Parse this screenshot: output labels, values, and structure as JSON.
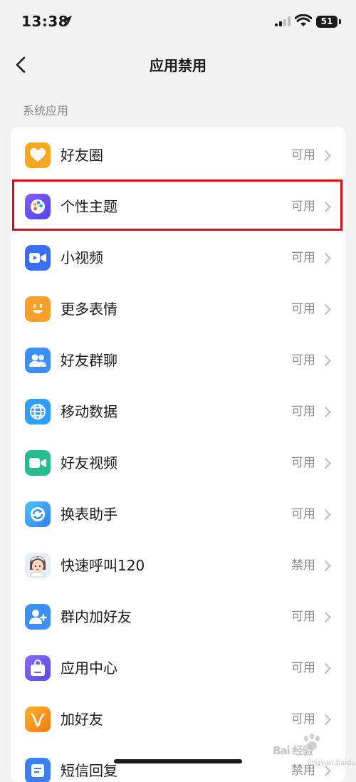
{
  "status_bar": {
    "time": "13:38",
    "battery": "51"
  },
  "nav": {
    "title": "应用禁用"
  },
  "section": {
    "label": "系统应用"
  },
  "apps": [
    {
      "name": "好友圈",
      "status": "可用",
      "icon": "heart-icon",
      "color": "#f5a623"
    },
    {
      "name": "个性主题",
      "status": "可用",
      "icon": "palette-icon",
      "color": "#6f55f2"
    },
    {
      "name": "小视频",
      "status": "可用",
      "icon": "video-camera-icon",
      "color": "#3b6ff3"
    },
    {
      "name": "更多表情",
      "status": "可用",
      "icon": "smiley-icon",
      "color": "#f6a12c"
    },
    {
      "name": "好友群聊",
      "status": "可用",
      "icon": "group-chat-icon",
      "color": "#3b8ff5"
    },
    {
      "name": "移动数据",
      "status": "可用",
      "icon": "globe-icon",
      "color": "#2d9ff5"
    },
    {
      "name": "好友视频",
      "status": "可用",
      "icon": "video-call-icon",
      "color": "#25bd8f"
    },
    {
      "name": "换表助手",
      "status": "可用",
      "icon": "sync-icon",
      "color": "#2f95f5"
    },
    {
      "name": "快速呼叫120",
      "status": "禁用",
      "icon": "nurse-avatar-icon",
      "color": "#e8eef5"
    },
    {
      "name": "群内加好友",
      "status": "可用",
      "icon": "add-friend-icon",
      "color": "#3b8ff5"
    },
    {
      "name": "应用中心",
      "status": "可用",
      "icon": "bag-icon",
      "color": "#7a5cf2"
    },
    {
      "name": "加好友",
      "status": "可用",
      "icon": "v-logo-icon",
      "color": "#f58d1a"
    },
    {
      "name": "短信回复",
      "status": "禁用",
      "icon": "message-icon",
      "color": "#3b7ff3"
    }
  ],
  "highlight": {
    "color": "#dd0d17"
  },
  "watermark": {
    "text": "Bai 经验",
    "sub": "jingyan.baidu.com"
  }
}
